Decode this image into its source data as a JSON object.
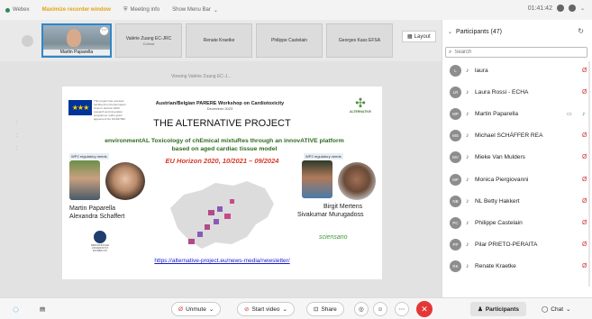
{
  "topbar": {
    "app_name": "Webex",
    "recording": "Maximize recorder window",
    "meeting_info": "Meeting info",
    "show_menu_bar": "Show Menu Bar",
    "timer": "01:41:42"
  },
  "filmstrip": {
    "tiles": [
      {
        "name": "Martin Paparella",
        "sub": ""
      },
      {
        "name": "Valérie Zuang EC-JRC",
        "sub": "Cohost"
      },
      {
        "name": "Renate Kraetke",
        "sub": ""
      },
      {
        "name": "Philippe Castelain",
        "sub": ""
      },
      {
        "name": "Georges Kass EFSA",
        "sub": ""
      }
    ],
    "layout_label": "Layout"
  },
  "stage": {
    "viewing": "Viewing Valérie Zuang EC-J..."
  },
  "slide": {
    "eu_text": "This project has received funding from the European Union's Horizon 2020 research and innovation programme under grant agreement No 101037090",
    "workshop": "Austrian/Belgian PARERE Workshop on Cardiotoxicity",
    "workshop_date": "December 2023",
    "alt_logo_text": "ALTERNATIVE",
    "title": "THE ALTERNATIVE PROJECT",
    "subtitle": "environmentAL Toxicology of chEmical mixtuRes through an innovATIVE platform based on aged cardiac tissue model",
    "horizon": "EU Horizon 2020, 10/2021 – 09/2024",
    "wp2_left": "WP2 regulatory needs",
    "wp2_right": "WP2 regulatory needs",
    "person_left_1": "Martin Paparella",
    "person_left_2": "Alexandra Schaffert",
    "person_right_1": "Birgit Mertens",
    "person_right_2": "Sivakumar Murugadoss",
    "uni_logo_text": "MEDIZINISCHE UNIVERSITÄT INNSBRUCK",
    "sciensano": "sciensano",
    "url": "https://alternative-project.eu/news-media/newsletter/"
  },
  "participants": {
    "header": "Participants (47)",
    "search_placeholder": "Search",
    "list": [
      {
        "initials": "L",
        "name": "laura",
        "muted": true,
        "cam": false
      },
      {
        "initials": "LR",
        "name": "Laura Rossi - ECHA",
        "muted": true,
        "cam": false
      },
      {
        "initials": "MP",
        "name": "Martin Paparella",
        "muted": false,
        "cam": true
      },
      {
        "initials": "MS",
        "name": "Michael SCHÄFFER REA",
        "muted": true,
        "cam": false
      },
      {
        "initials": "MV",
        "name": "Mieke Van Mulders",
        "muted": true,
        "cam": false
      },
      {
        "initials": "MP",
        "name": "Monica Piergiovanni",
        "muted": true,
        "cam": false
      },
      {
        "initials": "NB",
        "name": "NL Betty Hakkert",
        "muted": true,
        "cam": false
      },
      {
        "initials": "PC",
        "name": "Philippe Castelain",
        "muted": true,
        "cam": false
      },
      {
        "initials": "PP",
        "name": "Pilar PRIETO-PERAITA",
        "muted": true,
        "cam": false
      },
      {
        "initials": "RK",
        "name": "Renate Kraetke",
        "muted": true,
        "cam": false
      }
    ]
  },
  "bottombar": {
    "unmute": "Unmute",
    "start_video": "Start video",
    "share": "Share",
    "participants": "Participants",
    "chat": "Chat"
  },
  "colors": {
    "accent": "#2f86c8",
    "muted_red": "#d23535",
    "leave_red": "#e43737",
    "horizon_red": "#d6372a",
    "subtitle_green": "#2d6a1f"
  }
}
